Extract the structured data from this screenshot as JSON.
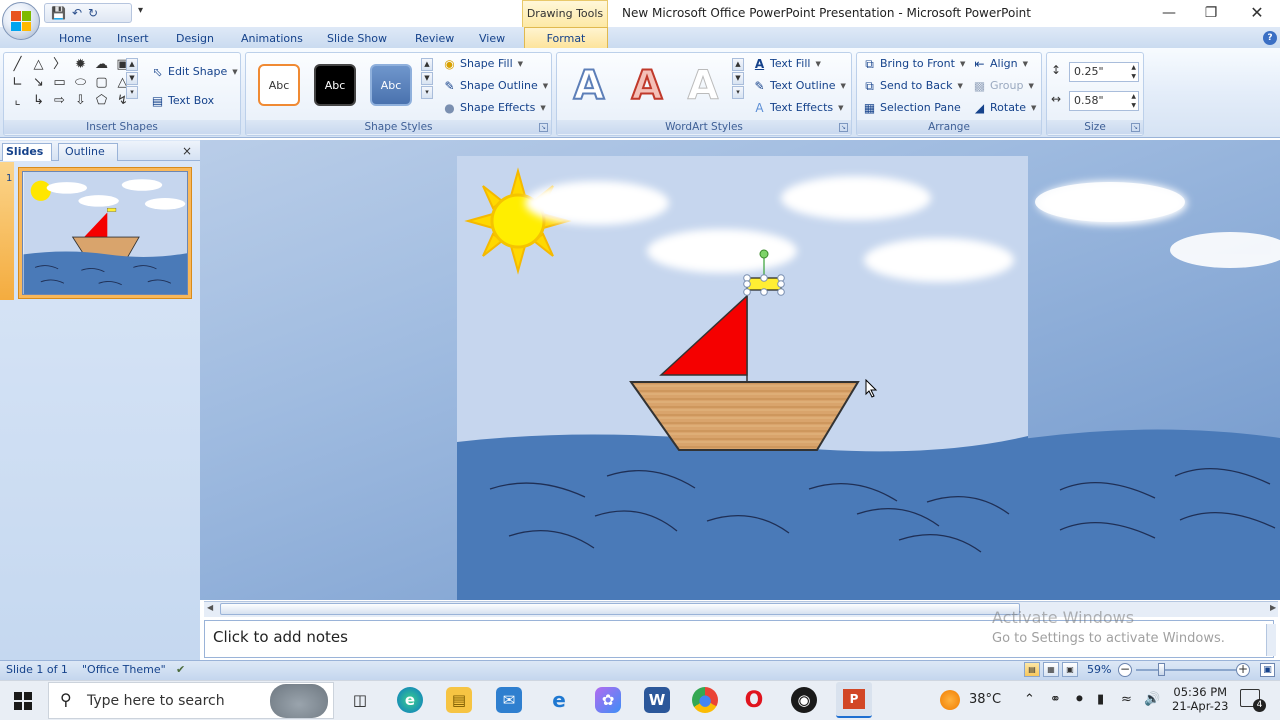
{
  "title_bar": {
    "window_title": "New Microsoft Office PowerPoint Presentation - Microsoft PowerPoint",
    "context_tab": "Drawing Tools"
  },
  "tabs": [
    "Home",
    "Insert",
    "Design",
    "Animations",
    "Slide Show",
    "Review",
    "View"
  ],
  "active_tab": "Format",
  "ribbon": {
    "insert_shapes": {
      "edit_shape": "Edit Shape",
      "text_box": "Text Box",
      "label": "Insert Shapes"
    },
    "shape_styles": {
      "swatch_text": "Abc",
      "fill": "Shape Fill",
      "outline": "Shape Outline",
      "effects": "Shape Effects",
      "label": "Shape Styles"
    },
    "wordart": {
      "letter": "A",
      "text_fill": "Text Fill",
      "text_outline": "Text Outline",
      "text_effects": "Text Effects",
      "label": "WordArt Styles"
    },
    "arrange": {
      "bring_front": "Bring to Front",
      "send_back": "Send to Back",
      "selection_pane": "Selection Pane",
      "align": "Align",
      "group": "Group",
      "rotate": "Rotate",
      "label": "Arrange"
    },
    "size": {
      "height": "0.25\"",
      "width": "0.58\"",
      "label": "Size"
    }
  },
  "panel": {
    "slides_tab": "Slides",
    "outline_tab": "Outline",
    "slide_number": "1"
  },
  "notes_placeholder": "Click to add notes",
  "watermark": {
    "title": "Activate Windows",
    "subtitle": "Go to Settings to activate Windows."
  },
  "status": {
    "slide_info": "Slide 1 of 1",
    "theme": "\"Office Theme\"",
    "zoom": "59%"
  },
  "taskbar": {
    "search_placeholder": "Type here to search",
    "temperature": "38°C",
    "time": "05:36 PM",
    "date": "21-Apr-23",
    "notifications": "4"
  },
  "colors": {
    "sail": "#f50000",
    "sea": "#4a7ab8",
    "sky": "#c6d6ee",
    "sun": "#ffe600",
    "hull": "#d9a46c",
    "flag": "#ffee33"
  }
}
